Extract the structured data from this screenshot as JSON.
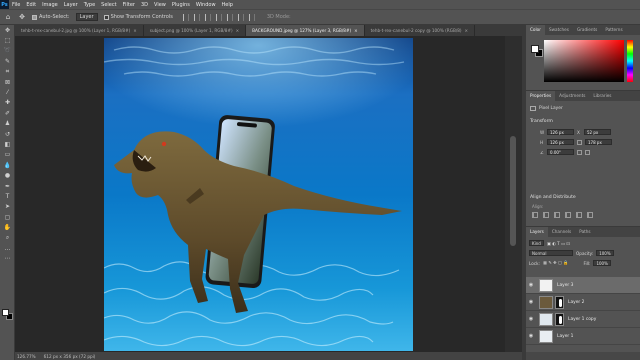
{
  "app": {
    "logo": "Ps"
  },
  "menu": [
    "File",
    "Edit",
    "Image",
    "Layer",
    "Type",
    "Select",
    "Filter",
    "3D",
    "View",
    "Plugins",
    "Window",
    "Help"
  ],
  "options": {
    "auto_select_label": "Auto-Select:",
    "auto_select_value": "Layer",
    "transform_controls_label": "Show Transform Controls",
    "mode_3d_label": "3D Mode:"
  },
  "tabs": [
    {
      "label": "tehb-t-rex-canebul-2.jpg @ 100% (Layer 1, RGB/8#)",
      "active": false
    },
    {
      "label": "subject.png @ 100% (Layer 1, RGB/8#)",
      "active": false
    },
    {
      "label": "BACKGROUND.jpeg @ 127% (Layer 3, RGB/8#)",
      "active": true
    },
    {
      "label": "tehb-t-rex-canebul-2 copy @ 100% (RGB/8)",
      "active": false
    }
  ],
  "status": {
    "zoom": "126.77%",
    "doc_info": "612 px x 356 px (72 ppi)"
  },
  "color_panel": {
    "tabs": [
      "Color",
      "Swatches",
      "Gradients",
      "Patterns"
    ],
    "fg_color": "#ffffff",
    "bg_color": "#000000"
  },
  "properties": {
    "tabs": [
      "Properties",
      "Adjustments",
      "Libraries"
    ],
    "layer_type": "Pixel Layer",
    "transform_title": "Transform",
    "w_label": "W",
    "w_value": "126 px",
    "x_label": "X",
    "x_value": "52 px",
    "h_label": "H",
    "h_value": "126 px",
    "y_value": "178 px",
    "angle_value": "0.00°",
    "align_title": "Align and Distribute",
    "align_label": "Align:"
  },
  "layers": {
    "tabs": [
      "Layers",
      "Channels",
      "Paths"
    ],
    "kind_label": "Kind",
    "blend_mode": "Normal",
    "opacity_label": "Opacity:",
    "opacity_value": "100%",
    "lock_label": "Lock:",
    "fill_label": "Fill:",
    "fill_value": "100%",
    "items": [
      {
        "name": "Layer 3",
        "selected": true,
        "has_mask": false
      },
      {
        "name": "Layer 2",
        "selected": false,
        "has_mask": true
      },
      {
        "name": "Layer 1 copy",
        "selected": false,
        "has_mask": true
      },
      {
        "name": "Layer 1",
        "selected": false,
        "has_mask": false
      }
    ]
  }
}
